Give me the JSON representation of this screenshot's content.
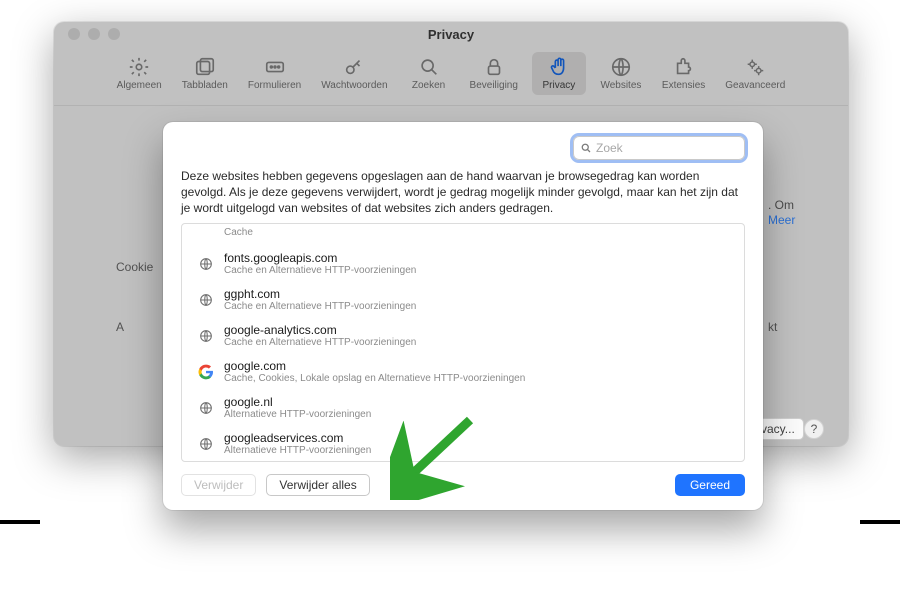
{
  "window": {
    "title": "Privacy"
  },
  "toolbar": {
    "items": [
      {
        "label": "Algemeen",
        "icon": "gear"
      },
      {
        "label": "Tabbladen",
        "icon": "tabs"
      },
      {
        "label": "Formulieren",
        "icon": "autofill"
      },
      {
        "label": "Wachtwoorden",
        "icon": "key"
      },
      {
        "label": "Zoeken",
        "icon": "search"
      },
      {
        "label": "Beveiliging",
        "icon": "lock"
      },
      {
        "label": "Privacy",
        "icon": "hand"
      },
      {
        "label": "Websites",
        "icon": "globe-grid"
      },
      {
        "label": "Extensies",
        "icon": "puzzle"
      },
      {
        "label": "Geavanceerd",
        "icon": "gears"
      }
    ],
    "active_index": 6
  },
  "background_fragments": {
    "left1": "Cookie",
    "left2": "A",
    "right1": ". Om",
    "right2": "Meer",
    "right3": "kt",
    "btn": "vacy...",
    "help": "?"
  },
  "modal": {
    "search_placeholder": "Zoek",
    "description": "Deze websites hebben gegevens opgeslagen aan de hand waarvan je browsegedrag kan worden gevolgd. Als je deze gegevens verwijdert, wordt je gedrag mogelijk minder gevolgd, maar kan het zijn dat je wordt uitgelogd van websites of dat websites zich anders gedragen.",
    "top_partial": "Cache",
    "rows": [
      {
        "site": "fonts.googleapis.com",
        "sub": "Cache en Alternatieve HTTP-voorzieningen",
        "icon": "globe"
      },
      {
        "site": "ggpht.com",
        "sub": "Cache en Alternatieve HTTP-voorzieningen",
        "icon": "globe"
      },
      {
        "site": "google-analytics.com",
        "sub": "Cache en Alternatieve HTTP-voorzieningen",
        "icon": "globe"
      },
      {
        "site": "google.com",
        "sub": "Cache, Cookies, Lokale opslag en Alternatieve HTTP-voorzieningen",
        "icon": "google"
      },
      {
        "site": "google.nl",
        "sub": "Alternatieve HTTP-voorzieningen",
        "icon": "globe"
      },
      {
        "site": "googleadservices.com",
        "sub": "Alternatieve HTTP-voorzieningen",
        "icon": "globe"
      }
    ],
    "buttons": {
      "remove": "Verwijder",
      "remove_all": "Verwijder alles",
      "done": "Gereed"
    }
  },
  "arrow_color": "#2fa52f"
}
